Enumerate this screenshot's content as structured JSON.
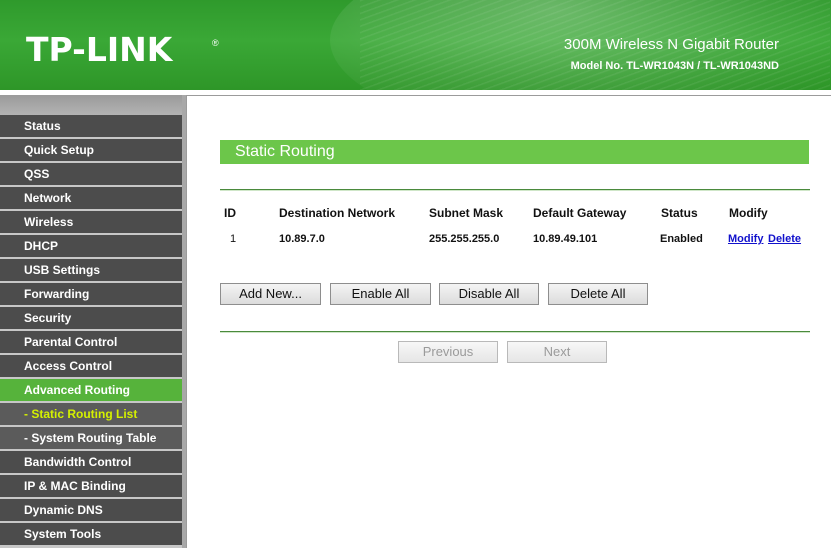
{
  "header": {
    "logo": "TP-LINK",
    "logo_mark": "®",
    "product_title": "300M Wireless N Gigabit Router",
    "model_no": "Model No. TL-WR1043N / TL-WR1043ND"
  },
  "sidebar": {
    "items": [
      {
        "label": "Status"
      },
      {
        "label": "Quick Setup"
      },
      {
        "label": "QSS"
      },
      {
        "label": "Network"
      },
      {
        "label": "Wireless"
      },
      {
        "label": "DHCP"
      },
      {
        "label": "USB Settings"
      },
      {
        "label": "Forwarding"
      },
      {
        "label": "Security"
      },
      {
        "label": "Parental Control"
      },
      {
        "label": "Access Control"
      },
      {
        "label": "Advanced Routing"
      },
      {
        "label": "- Static Routing List"
      },
      {
        "label": "- System Routing Table"
      },
      {
        "label": "Bandwidth Control"
      },
      {
        "label": "IP & MAC Binding"
      },
      {
        "label": "Dynamic DNS"
      },
      {
        "label": "System Tools"
      }
    ]
  },
  "main": {
    "title": "Static Routing",
    "table": {
      "headers": [
        "ID",
        "Destination Network",
        "Subnet Mask",
        "Default Gateway",
        "Status",
        "Modify"
      ],
      "rows": [
        {
          "id": "1",
          "destination": "10.89.7.0",
          "mask": "255.255.255.0",
          "gateway": "10.89.49.101",
          "status": "Enabled",
          "modify": "Modify",
          "delete": "Delete"
        }
      ]
    },
    "buttons": {
      "add_new": "Add New...",
      "enable_all": "Enable All",
      "disable_all": "Disable All",
      "delete_all": "Delete All",
      "previous": "Previous",
      "next": "Next"
    }
  },
  "colors": {
    "brand_green": "#3aa836",
    "menu_dark": "#4c4c4c",
    "menu_active": "#56b33b",
    "submenu_active_text": "#d4f000",
    "title_bar": "#6cc64a",
    "link": "#1111cc"
  }
}
